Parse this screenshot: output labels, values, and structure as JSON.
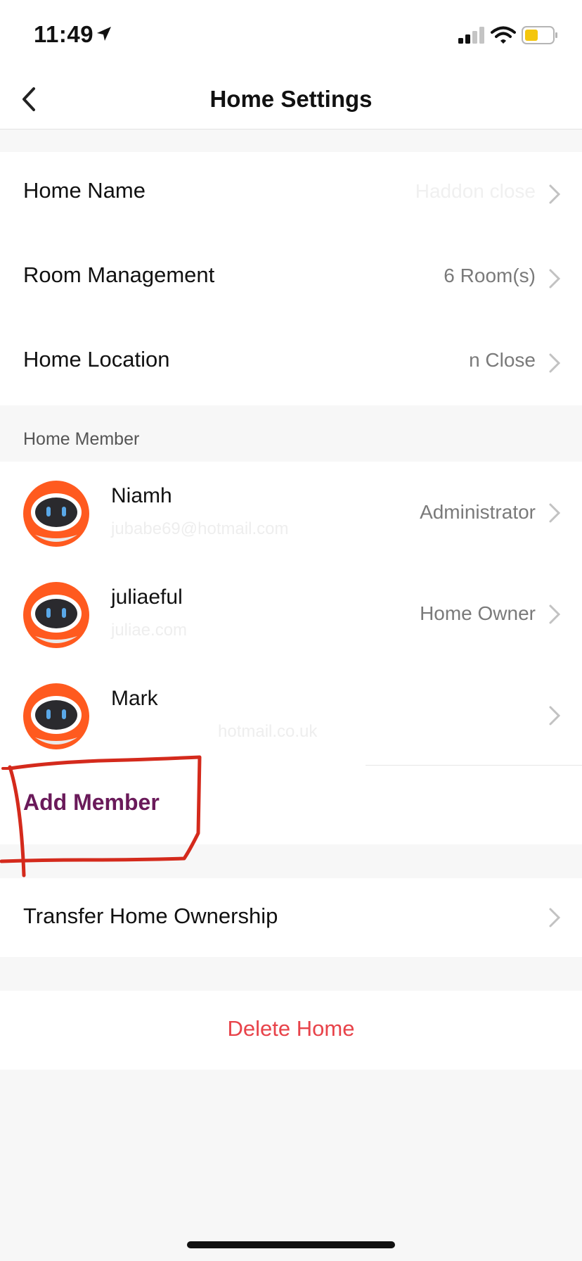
{
  "status_bar": {
    "time": "11:49"
  },
  "nav": {
    "title": "Home Settings"
  },
  "settings": {
    "home_name": {
      "label": "Home Name",
      "value": "Haddon close"
    },
    "room_management": {
      "label": "Room Management",
      "value": "6 Room(s)"
    },
    "home_location": {
      "label": "Home Location",
      "value": "n Close"
    }
  },
  "members_section": {
    "header": "Home Member",
    "members": [
      {
        "name": "Niamh",
        "email": "jubabe69@hotmail.com",
        "role": "Administrator"
      },
      {
        "name": "juliaeful",
        "email": "juliae.com",
        "role": "Home Owner"
      },
      {
        "name": "Mark",
        "email": "hotmail.co.uk",
        "role": ""
      }
    ],
    "add_label": "Add Member"
  },
  "transfer": {
    "label": "Transfer Home Ownership"
  },
  "delete": {
    "label": "Delete Home"
  },
  "colors": {
    "accent": "#6a1a5a",
    "danger": "#e8434a",
    "annotation": "#d42a1c",
    "avatar": "#ff5a1f"
  },
  "icons": [
    "location-arrow-icon",
    "signal-icon",
    "wifi-icon",
    "battery-icon",
    "back-chevron-icon",
    "chevron-right-icon",
    "robot-avatar-icon"
  ]
}
